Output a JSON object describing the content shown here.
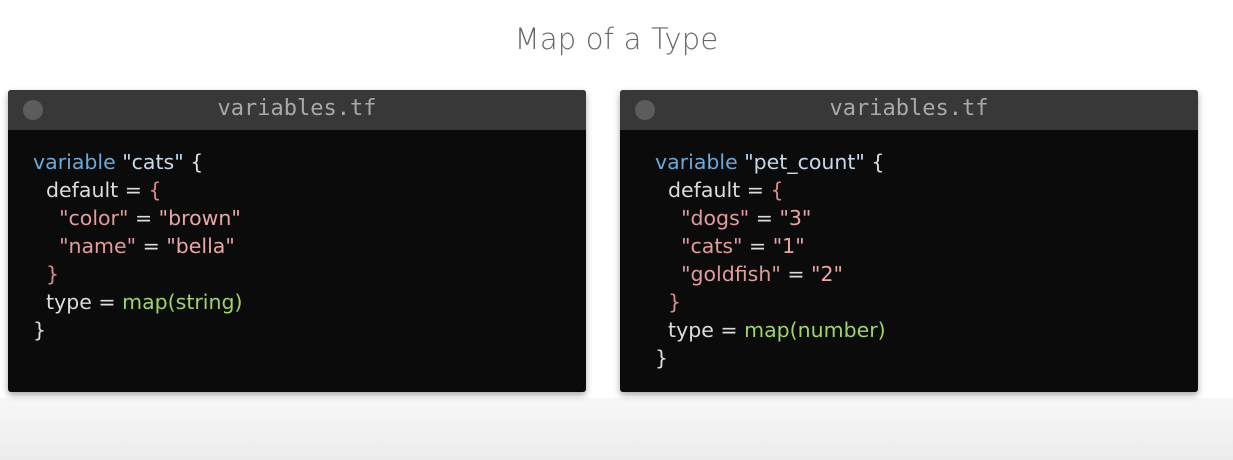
{
  "title": "Map of a Type",
  "panels": [
    {
      "filename": "variables.tf",
      "variable_keyword": "variable",
      "variable_name": "\"cats\"",
      "default_keyword": "default",
      "entries": [
        {
          "key": "\"color\"",
          "value": "\"brown\""
        },
        {
          "key": "\"name\"",
          "value": "\"bella\""
        }
      ],
      "type_keyword": "type",
      "type_fn": "map(string)"
    },
    {
      "filename": "variables.tf",
      "variable_keyword": "variable",
      "variable_name": "\"pet_count\"",
      "default_keyword": "default",
      "entries": [
        {
          "key": "\"dogs\"",
          "value": "\"3\""
        },
        {
          "key": "\"cats\"",
          "value": "\"1\""
        },
        {
          "key": "\"goldfish\"",
          "value": "\"2\""
        }
      ],
      "type_keyword": "type",
      "type_fn": "map(number)"
    }
  ]
}
